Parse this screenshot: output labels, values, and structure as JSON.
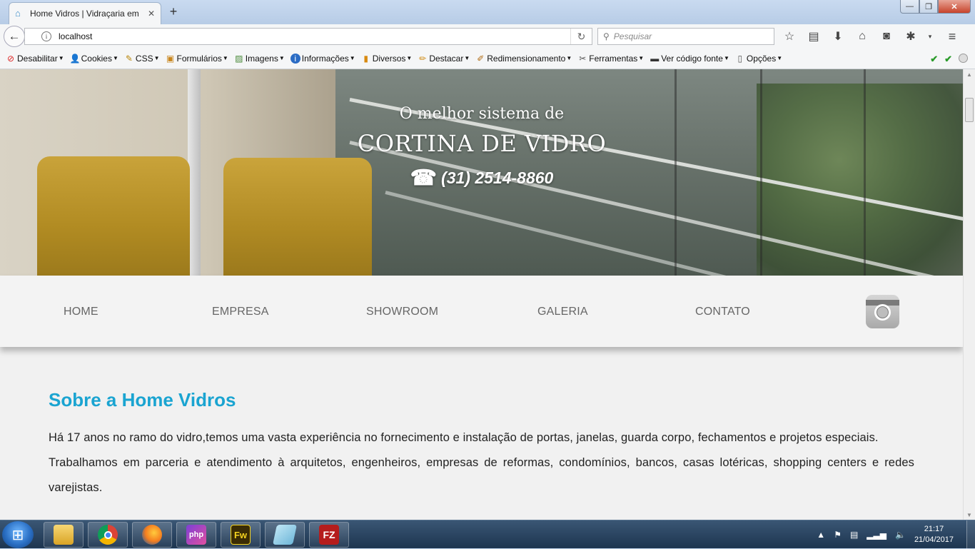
{
  "browser": {
    "tab_title": "Home Vidros | Vidraçaria em",
    "tab_close": "✕",
    "new_tab": "+",
    "url": "localhost",
    "search_placeholder": "Pesquisar",
    "window_controls": {
      "minimize": "—",
      "maximize": "❐",
      "close": "✕"
    }
  },
  "devbar": {
    "items": [
      {
        "label": "Desabilitar",
        "icon": "disable-icon"
      },
      {
        "label": "Cookies",
        "icon": "cookies-icon"
      },
      {
        "label": "CSS",
        "icon": "css-icon"
      },
      {
        "label": "Formulários",
        "icon": "forms-icon"
      },
      {
        "label": "Imagens",
        "icon": "images-icon"
      },
      {
        "label": "Informações",
        "icon": "info-icon"
      },
      {
        "label": "Diversos",
        "icon": "misc-icon"
      },
      {
        "label": "Destacar",
        "icon": "highlight-icon"
      },
      {
        "label": "Redimensionamento",
        "icon": "resize-icon"
      },
      {
        "label": "Ferramentas",
        "icon": "tools-icon"
      },
      {
        "label": "Ver código fonte",
        "icon": "source-icon"
      },
      {
        "label": "Opções",
        "icon": "options-icon"
      }
    ]
  },
  "hero": {
    "line1": "O melhor sistema de",
    "line2": "CORTINA DE VIDRO",
    "phone": "(31) 2514-8860"
  },
  "menu": {
    "items": [
      "HOME",
      "EMPRESA",
      "SHOWROOM",
      "GALERIA",
      "CONTATO"
    ]
  },
  "about": {
    "title": "Sobre a Home Vidros",
    "p1": "Há 17 anos no ramo do vidro,temos uma vasta experiência no fornecimento e instalação de portas, janelas, guarda corpo, fechamentos e projetos especiais.",
    "p2": "Trabalhamos em parceria e atendimento à arquitetos, engenheiros, empresas de reformas, condomínios, bancos, casas lotéricas, shopping centers e redes varejistas."
  },
  "taskbar": {
    "time": "21:17",
    "date": "21/04/2017",
    "apps": [
      {
        "name": "explorer",
        "label": ""
      },
      {
        "name": "chrome",
        "label": ""
      },
      {
        "name": "firefox",
        "label": ""
      },
      {
        "name": "phpstorm",
        "label": "php"
      },
      {
        "name": "fireworks",
        "label": "Fw"
      },
      {
        "name": "notes",
        "label": ""
      },
      {
        "name": "filezilla",
        "label": "FZ"
      }
    ]
  },
  "colors": {
    "accent": "#1aa4d1",
    "menu_text": "#666666",
    "page_bg": "#f1f1f1"
  }
}
